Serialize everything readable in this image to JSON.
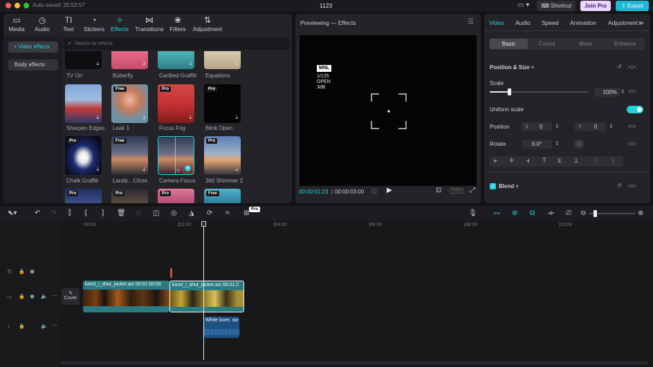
{
  "titlebar": {
    "autosave": "Auto saved: 20:53:57",
    "project": "1123",
    "shortcut": "Shortcut",
    "join_pro": "Join Pro",
    "export": "Export"
  },
  "media_tabs": [
    {
      "label": "Media",
      "icon": "media-icon"
    },
    {
      "label": "Audio",
      "icon": "audio-icon"
    },
    {
      "label": "Text",
      "icon": "text-icon"
    },
    {
      "label": "Stickers",
      "icon": "stickers-icon"
    },
    {
      "label": "Effects",
      "icon": "effects-icon",
      "active": true
    },
    {
      "label": "Transitions",
      "icon": "transitions-icon"
    },
    {
      "label": "Filters",
      "icon": "filters-icon"
    },
    {
      "label": "Adjustment",
      "icon": "adjustment-icon"
    }
  ],
  "effects_sidebar": {
    "video_effects": "• Video effects",
    "body_effects": "Body effects"
  },
  "search": {
    "placeholder": "Search for effects"
  },
  "effects": {
    "row1": [
      "TV On",
      "Butterfly",
      "Garbled Graffiti",
      "Equations"
    ],
    "row2": [
      {
        "name": "Sharpen Edges",
        "badge": ""
      },
      {
        "name": "Leak 1",
        "badge": "Free"
      },
      {
        "name": "Focus Fog",
        "badge": "Pro"
      },
      {
        "name": "Blink Open",
        "badge": "Pro"
      }
    ],
    "row3": [
      {
        "name": "Chalk Graffiti",
        "badge": "Pro"
      },
      {
        "name": "Lands…Close",
        "badge": "Free"
      },
      {
        "name": "Camera Focus",
        "badge": ""
      },
      {
        "name": "360 Shimmer 2",
        "badge": "Pro"
      }
    ],
    "row4_badges": [
      "Pro",
      "Pro",
      "Pro",
      "Free"
    ]
  },
  "preview": {
    "title": "Previewing — Effects",
    "overlay_tag": "MNL",
    "overlay_lines": [
      "1/125",
      "OPEN",
      "3dB"
    ],
    "current_time": "00:00:01:23",
    "total_time": "00:00:03:00",
    "ratio": "Ratio"
  },
  "inspector": {
    "tabs": [
      "Video",
      "Audio",
      "Speed",
      "Animation",
      "Adjustment"
    ],
    "subtabs": [
      "Basic",
      "Cutout",
      "Mask",
      "Enhance"
    ],
    "position_size": "Position & Size",
    "scale_label": "Scale",
    "scale_value": "100%",
    "uniform_scale": "Uniform scale",
    "position_label": "Position",
    "pos_x_label": "X",
    "pos_x": "0",
    "pos_y_label": "Y",
    "pos_y": "0",
    "rotate_label": "Rotate",
    "rotate_value": "0.0°",
    "rotate_dash": "-",
    "blend": "Blend"
  },
  "timeline": {
    "ruler": [
      "00:00",
      "|02:00",
      "|04:00",
      "|06:00",
      "|08:00",
      "|10:00"
    ],
    "cover": "Cover",
    "clip1": "korol_i_shut_jocker.avi  00:01:50:00",
    "clip2": "korol_i_shut_jocker.avi  00:01:2",
    "audio_clip": "White lover, sw",
    "pro_badge": "Pro"
  },
  "colors": {
    "accent": "#22d3dd",
    "join_pro": "#e9d5ff",
    "export": "#1fb8d4",
    "clip_video": "#2a7c80",
    "clip_audio": "#1d4f80"
  }
}
